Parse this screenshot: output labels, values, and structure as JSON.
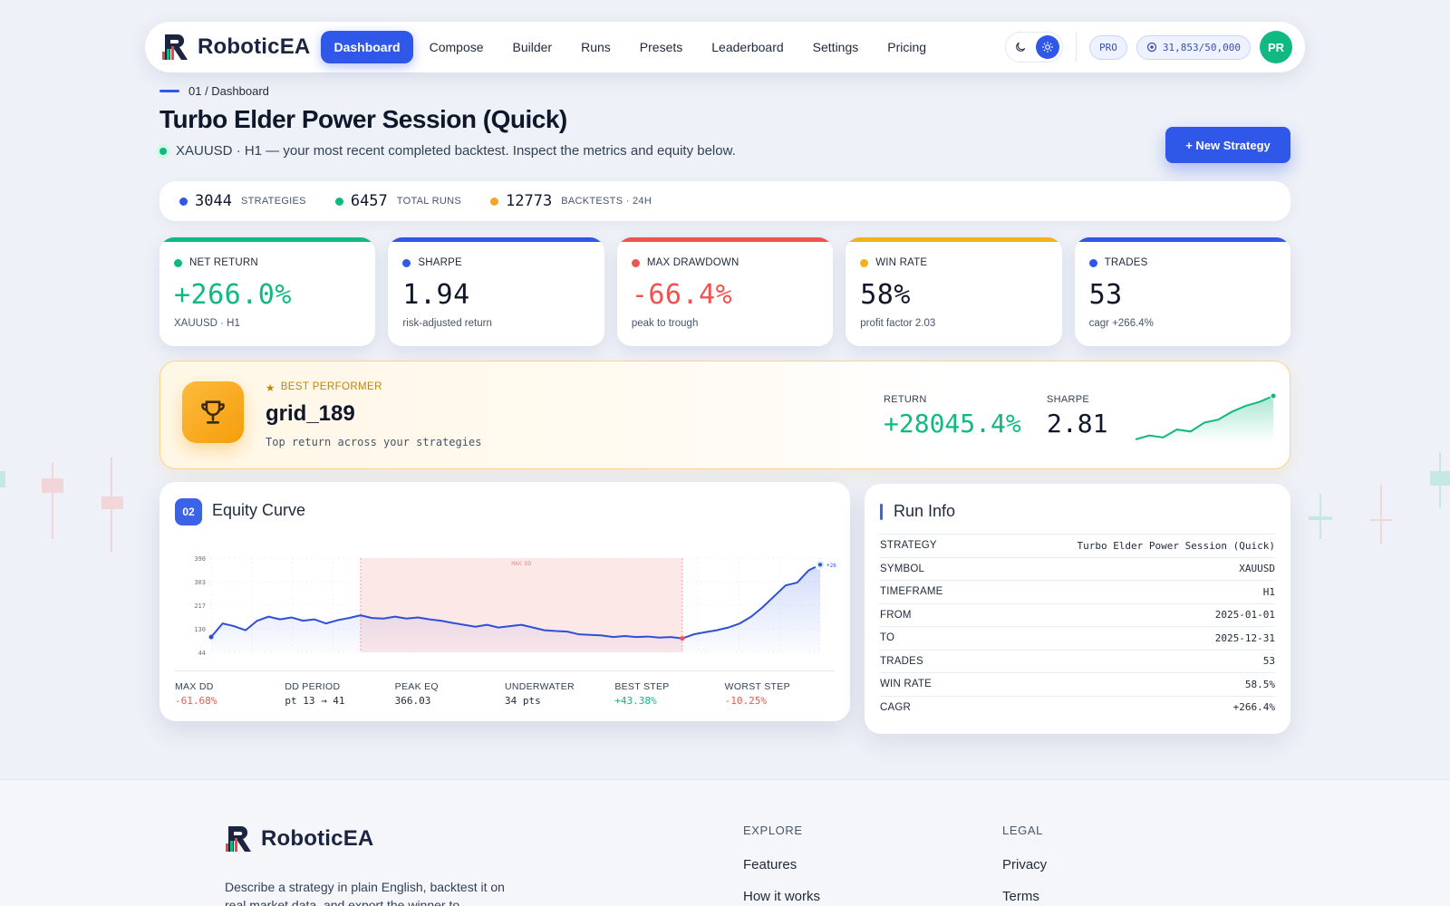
{
  "brand": {
    "name": "RoboticEA"
  },
  "nav": {
    "items": [
      {
        "label": "Dashboard",
        "active": true
      },
      {
        "label": "Compose"
      },
      {
        "label": "Builder"
      },
      {
        "label": "Runs"
      },
      {
        "label": "Presets"
      },
      {
        "label": "Leaderboard"
      },
      {
        "label": "Settings"
      },
      {
        "label": "Pricing"
      }
    ],
    "plan_badge": "PRO",
    "credits": "31,853/50,000",
    "avatar_initials": "PR"
  },
  "header": {
    "breadcrumb": "01 / Dashboard",
    "title": "Turbo Elder Power Session (Quick)",
    "subtitle": "XAUUSD · H1 — your most recent completed backtest. Inspect the metrics and equity below.",
    "new_button": "+ New Strategy"
  },
  "stats": [
    {
      "value": "3044",
      "label": "STRATEGIES",
      "color": "#2f57e8"
    },
    {
      "value": "6457",
      "label": "TOTAL RUNS",
      "color": "#10b981"
    },
    {
      "value": "12773",
      "label": "BACKTESTS · 24H",
      "color": "#f5a623"
    }
  ],
  "metrics": [
    {
      "label": "NET RETURN",
      "value": "+266.0%",
      "sub": "XAUUSD · H1",
      "color": "#10b981",
      "value_color": "#10b981"
    },
    {
      "label": "SHARPE",
      "value": "1.94",
      "sub": "risk-adjusted return",
      "color": "#2f57e8",
      "value_color": "#0f172a"
    },
    {
      "label": "MAX DRAWDOWN",
      "value": "-66.4%",
      "sub": "peak to trough",
      "color": "#ef5350",
      "value_color": "#ef5350"
    },
    {
      "label": "WIN RATE",
      "value": "58%",
      "sub": "profit factor 2.03",
      "color": "#f5b01a",
      "value_color": "#0f172a"
    },
    {
      "label": "TRADES",
      "value": "53",
      "sub": "cagr +266.4%",
      "color": "#2f57e8",
      "value_color": "#0f172a"
    }
  ],
  "best": {
    "tag": "BEST PERFORMER",
    "name": "grid_189",
    "desc": "Top return across your strategies",
    "return_label": "RETURN",
    "return_value": "+28045.4%",
    "sharpe_label": "SHARPE",
    "sharpe_value": "2.81",
    "spark": [
      10,
      14,
      12,
      20,
      18,
      27,
      30,
      38,
      44,
      48,
      54
    ]
  },
  "equity": {
    "badge": "02",
    "title": "Equity Curve",
    "dd_label": "MAX DD",
    "end_label": "+26",
    "stats": [
      {
        "label": "MAX DD",
        "value": "-61.68%",
        "color": "#ef5350"
      },
      {
        "label": "DD PERIOD",
        "value": "pt 13 → 41",
        "color": "#1e293b"
      },
      {
        "label": "PEAK EQ",
        "value": "366.03",
        "color": "#1e293b"
      },
      {
        "label": "UNDERWATER",
        "value": "34 pts",
        "color": "#1e293b"
      },
      {
        "label": "BEST STEP",
        "value": "+43.38%",
        "color": "#10b981"
      },
      {
        "label": "WORST STEP",
        "value": "-10.25%",
        "color": "#ef5350"
      }
    ]
  },
  "chart_data": {
    "type": "line",
    "title": "Equity Curve",
    "y_ticks": [
      44,
      130,
      217,
      303,
      390
    ],
    "ylim": [
      44,
      390
    ],
    "drawdown_range": [
      13,
      41
    ],
    "values": [
      100,
      150,
      140,
      125,
      160,
      175,
      165,
      172,
      160,
      165,
      150,
      162,
      170,
      180,
      170,
      168,
      175,
      168,
      172,
      165,
      160,
      152,
      145,
      138,
      145,
      135,
      140,
      145,
      135,
      125,
      122,
      120,
      110,
      108,
      106,
      100,
      104,
      100,
      102,
      98,
      100,
      95,
      110,
      118,
      125,
      135,
      150,
      175,
      210,
      250,
      290,
      300,
      345,
      366
    ]
  },
  "runinfo": {
    "title": "Run Info",
    "rows": [
      {
        "k": "STRATEGY",
        "v": "Turbo Elder Power Session (Quick)"
      },
      {
        "k": "SYMBOL",
        "v": "XAUUSD"
      },
      {
        "k": "TIMEFRAME",
        "v": "H1"
      },
      {
        "k": "FROM",
        "v": "2025-01-01"
      },
      {
        "k": "TO",
        "v": "2025-12-31"
      },
      {
        "k": "TRADES",
        "v": "53"
      },
      {
        "k": "WIN RATE",
        "v": "58.5%"
      },
      {
        "k": "CAGR",
        "v": "+266.4%"
      }
    ]
  },
  "footer": {
    "desc": "Describe a strategy in plain English, backtest it on real market data, and export the winner to",
    "explore": {
      "heading": "EXPLORE",
      "items": [
        "Features",
        "How it works"
      ]
    },
    "legal": {
      "heading": "LEGAL",
      "items": [
        "Privacy",
        "Terms"
      ]
    }
  },
  "icons": {
    "theme_dark": "moon-icon",
    "theme_light": "sun-icon",
    "credits": "coin-icon",
    "trophy": "trophy-icon",
    "star": "star-icon"
  }
}
